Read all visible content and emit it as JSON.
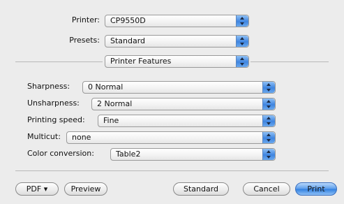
{
  "header": {
    "printer": {
      "label": "Printer:",
      "value": "CP9550D"
    },
    "presets": {
      "label": "Presets:",
      "value": "Standard"
    },
    "panel": {
      "value": "Printer Features"
    }
  },
  "features": [
    {
      "label": "Sharpness:",
      "value": "0 Normal"
    },
    {
      "label": "Unsharpness:",
      "value": "2 Normal"
    },
    {
      "label": "Printing speed:",
      "value": "Fine"
    },
    {
      "label": "Multicut:",
      "value": "none"
    },
    {
      "label": "Color conversion:",
      "value": "Table2"
    }
  ],
  "buttons": {
    "pdf": "PDF ▾",
    "preview": "Preview",
    "standard": "Standard",
    "cancel": "Cancel",
    "print": "Print"
  }
}
